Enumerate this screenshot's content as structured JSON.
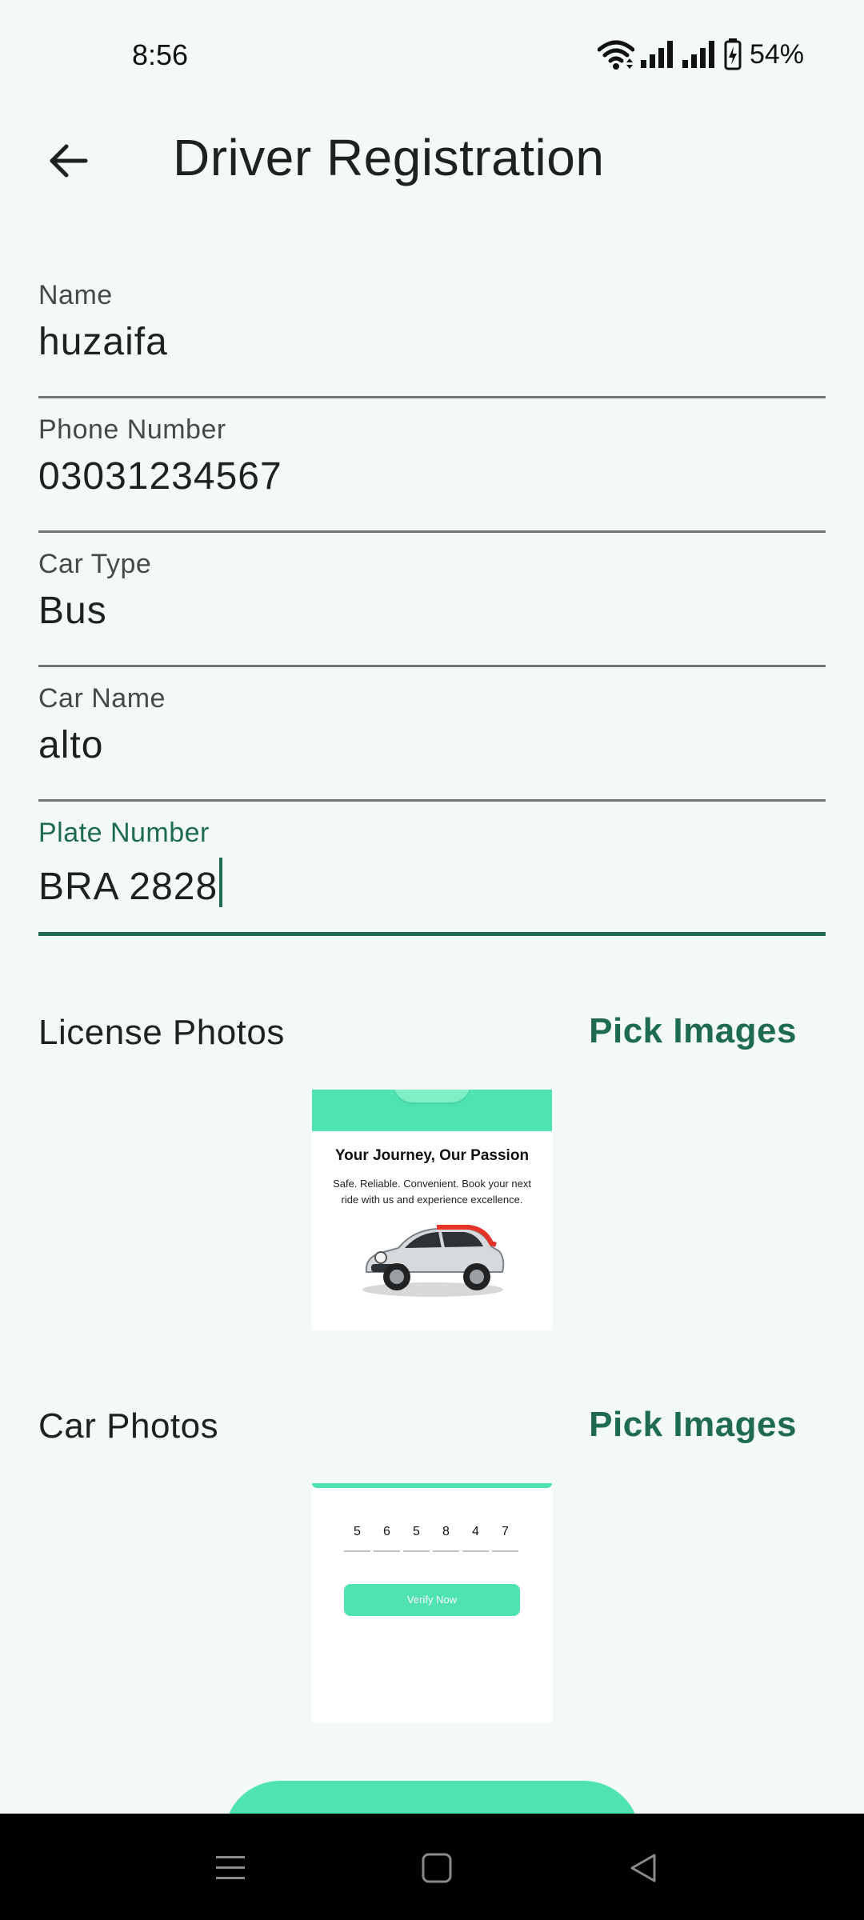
{
  "status_bar": {
    "time": "8:56",
    "battery": "54%"
  },
  "app_bar": {
    "title": "Driver Registration",
    "back_icon": "arrow-left-icon"
  },
  "form": {
    "fields": [
      {
        "label": "Name",
        "value": "huzaifa",
        "focused": false
      },
      {
        "label": "Phone Number",
        "value": "03031234567",
        "focused": false
      },
      {
        "label": "Car Type",
        "value": "Bus",
        "focused": false
      },
      {
        "label": "Car Name",
        "value": "alto",
        "focused": false
      },
      {
        "label": "Plate Number",
        "value": "BRA 2828",
        "focused": true
      }
    ]
  },
  "license_photos": {
    "title": "License Photos",
    "pick_label": "Pick Images",
    "thumbnail": {
      "heading": "Your Journey, Our Passion",
      "subtext": "Safe. Reliable. Convenient. Book your next ride with us and experience excellence."
    }
  },
  "car_photos": {
    "title": "Car Photos",
    "pick_label": "Pick Images",
    "thumbnail": {
      "otp_digits": [
        "5",
        "6",
        "5",
        "8",
        "4",
        "7"
      ],
      "verify_label": "Verify Now"
    }
  },
  "colors": {
    "background": "#f3faf5",
    "accent": "#1e6b52",
    "mint": "#4ee3b0"
  },
  "nav_bar": {
    "icons": [
      "menu-icon",
      "home-square-icon",
      "back-triangle-icon"
    ]
  }
}
